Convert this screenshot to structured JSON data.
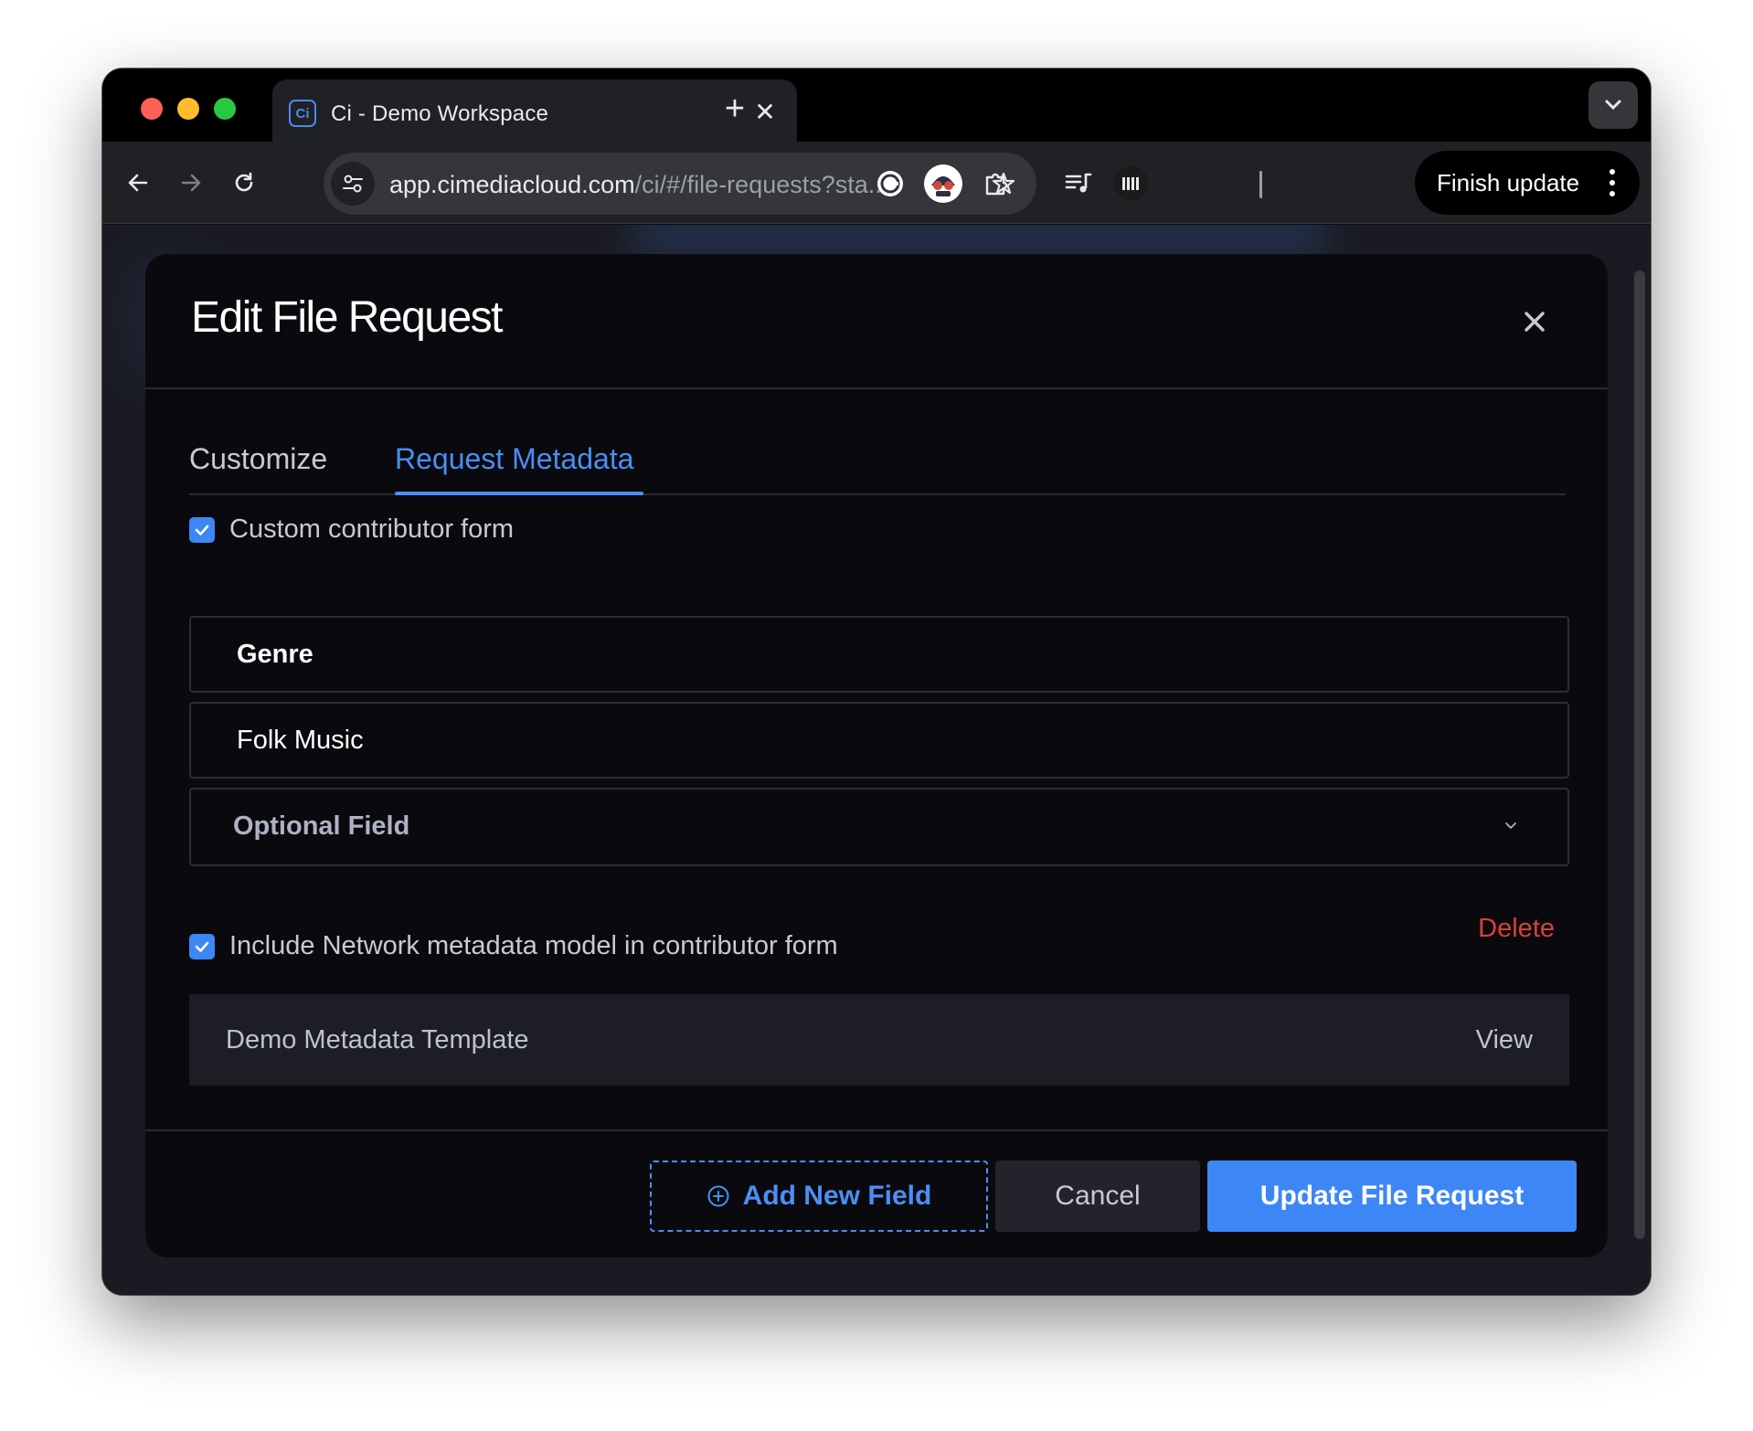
{
  "browser": {
    "tab": {
      "title": "Ci - Demo Workspace",
      "favicon_text": "Ci"
    },
    "address": {
      "host": "app.cimediacloud.com",
      "path": "/ci/#/file-requests?sta..."
    },
    "finish_update_label": "Finish update",
    "extensions": [
      "grammarly-icon",
      "avatar-extension-icon",
      "puzzle-icon",
      "media-queue-icon",
      "shhs-extension-icon"
    ]
  },
  "modal": {
    "title": "Edit File Request",
    "tabs": [
      {
        "label": "Customize",
        "active": false
      },
      {
        "label": "Request Metadata",
        "active": true
      }
    ],
    "custom_form": {
      "label": "Custom contributor form",
      "checked": true
    },
    "field": {
      "name": "Genre",
      "value": "Folk Music",
      "requirement": "Optional Field",
      "delete_label": "Delete"
    },
    "network_metadata": {
      "label": "Include Network metadata model in contributor form",
      "checked": true
    },
    "template": {
      "name": "Demo Metadata Template",
      "view_label": "View"
    },
    "buttons": {
      "add_field": "Add New Field",
      "cancel": "Cancel",
      "update": "Update File Request"
    }
  },
  "colors": {
    "accent": "#3d86f5",
    "danger": "#d6423b",
    "modal_bg": "#0a0a0e"
  }
}
